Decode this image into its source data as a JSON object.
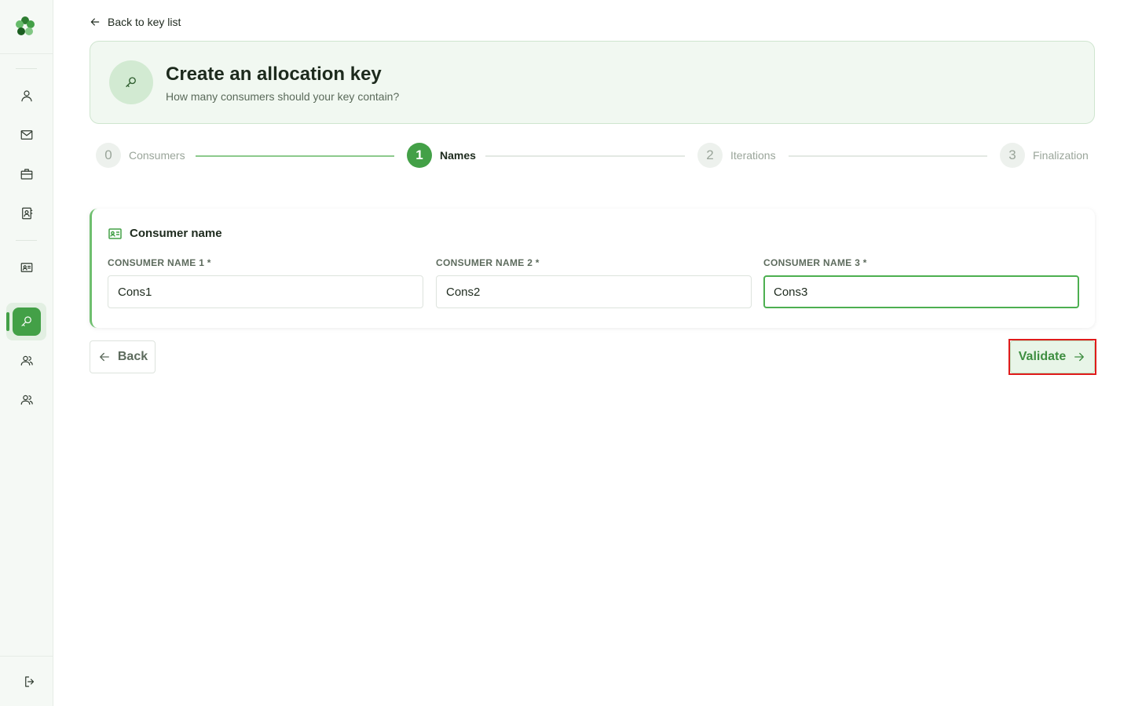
{
  "nav": {
    "back_link": "Back to key list"
  },
  "hero": {
    "title": "Create an allocation key",
    "subtitle": "How many consumers should your key contain?",
    "icon": "key-icon"
  },
  "stepper": {
    "steps": [
      {
        "number": "0",
        "label": "Consumers",
        "state": "done"
      },
      {
        "number": "1",
        "label": "Names",
        "state": "active"
      },
      {
        "number": "2",
        "label": "Iterations",
        "state": "pending"
      },
      {
        "number": "3",
        "label": "Finalization",
        "state": "pending"
      }
    ]
  },
  "card": {
    "title": "Consumer name",
    "fields": [
      {
        "label": "CONSUMER NAME 1 *",
        "value": "Cons1"
      },
      {
        "label": "CONSUMER NAME 2 *",
        "value": "Cons2"
      },
      {
        "label": "CONSUMER NAME 3 *",
        "value": "Cons3"
      }
    ]
  },
  "actions": {
    "back_label": "Back",
    "validate_label": "Validate"
  },
  "sidebar": {
    "items": [
      {
        "icon": "user-icon"
      },
      {
        "icon": "mail-icon"
      },
      {
        "icon": "briefcase-icon"
      },
      {
        "icon": "contact-book-icon"
      },
      {
        "icon": "id-card-icon"
      },
      {
        "icon": "key-icon",
        "active": true
      },
      {
        "icon": "users-icon"
      },
      {
        "icon": "users-icon"
      },
      {
        "icon": "logout-icon"
      }
    ]
  },
  "colors": {
    "accent": "#43a047",
    "highlight": "#e01b1b"
  }
}
